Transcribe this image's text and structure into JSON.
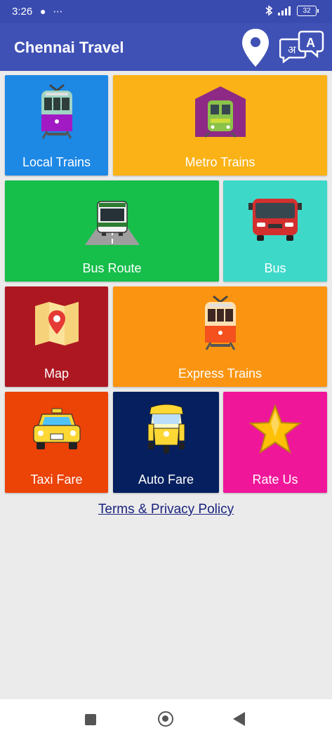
{
  "status_bar": {
    "time": "3:26",
    "left_icons": "● ⋯",
    "battery": "32"
  },
  "app_bar": {
    "title": "Chennai Travel"
  },
  "tiles": [
    {
      "label": "Local Trains",
      "color": "#1e88e5"
    },
    {
      "label": "Metro Trains",
      "color": "#fbb216"
    },
    {
      "label": "Bus Route",
      "color": "#16be4a"
    },
    {
      "label": "Bus",
      "color": "#3ed8c8"
    },
    {
      "label": "Map",
      "color": "#ad1721"
    },
    {
      "label": "Express Trains",
      "color": "#fb9511"
    },
    {
      "label": "Taxi Fare",
      "color": "#ec4307"
    },
    {
      "label": "Auto Fare",
      "color": "#06205f"
    },
    {
      "label": "Rate Us",
      "color": "#f0169a"
    }
  ],
  "footer": {
    "terms_link": "Terms & Privacy Policy"
  }
}
